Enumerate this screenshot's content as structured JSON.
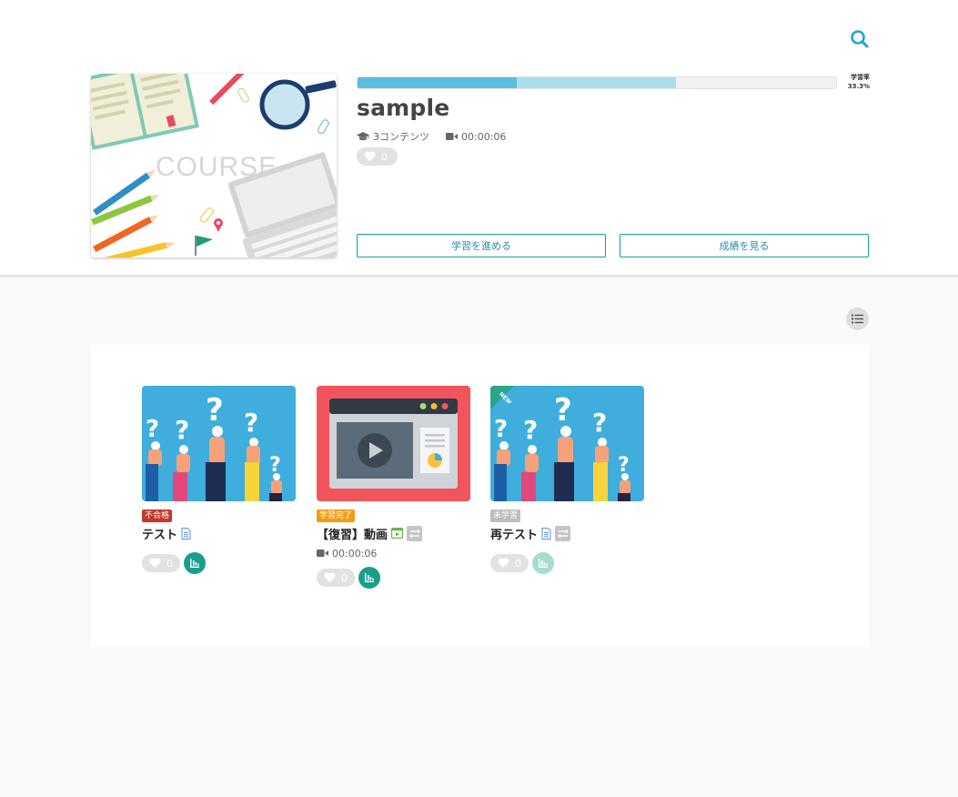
{
  "course": {
    "title": "sample",
    "contents_count": "3コンテンツ",
    "duration": "00:00:06",
    "likes": "0",
    "progress_label": "学習率",
    "progress_value": "33.3%",
    "progress_completed": 0.333,
    "progress_in_progress": 0.333,
    "thumb_text": "COURSE",
    "continue_button": "学習を進める",
    "results_button": "成績を見る"
  },
  "contents": [
    {
      "title": "テスト",
      "badge": "不合格",
      "badge_color": "#c0392b",
      "type_icon": "document-icon",
      "likes": "0",
      "duration": "",
      "grade_icon_color": "#1a9e8a"
    },
    {
      "title": "【復習】動画",
      "badge": "学習完了",
      "badge_color": "#f39c12",
      "type_icon": "video-icon",
      "likes": "0",
      "duration": "00:00:06",
      "grade_icon_color": "#1a9e8a"
    },
    {
      "title": "再テスト",
      "badge": "未学習",
      "badge_color": "#bdbdbd",
      "type_icon": "document-icon",
      "likes": "0",
      "duration": "",
      "grade_icon_color": "#a6dccf",
      "ribbon": "NEW"
    }
  ],
  "colors": {
    "accent": "#1fa9cc",
    "button_border": "#11a0a6",
    "progress_done": "#5bbedf",
    "progress_partial": "#a8def0"
  }
}
